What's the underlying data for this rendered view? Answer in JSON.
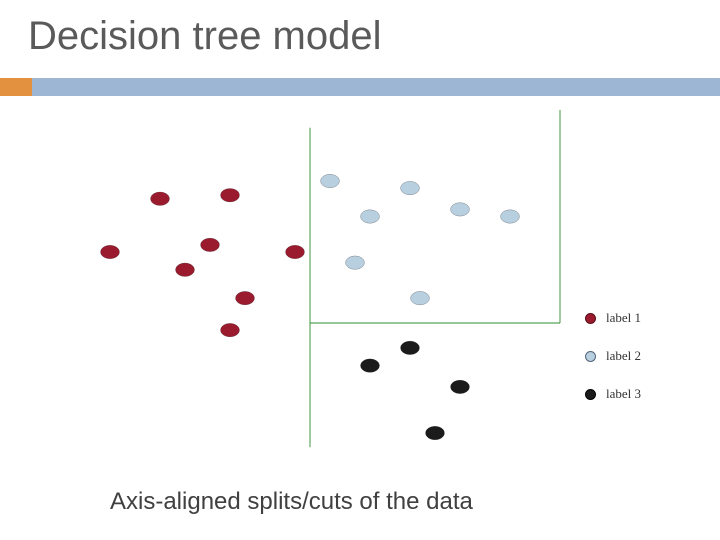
{
  "title": "Decision tree model",
  "caption": "Axis-aligned splits/cuts of the data",
  "legend": {
    "items": [
      {
        "label": "label 1"
      },
      {
        "label": "label 2"
      },
      {
        "label": "label 3"
      }
    ]
  },
  "chart_data": {
    "type": "scatter",
    "title": "",
    "xlabel": "",
    "ylabel": "",
    "xlim": [
      0,
      100
    ],
    "ylim": [
      0,
      100
    ],
    "series": [
      {
        "name": "label 1",
        "color": "#9a1b2e",
        "points": [
          {
            "x": 8,
            "y": 60
          },
          {
            "x": 18,
            "y": 75
          },
          {
            "x": 23,
            "y": 55
          },
          {
            "x": 28,
            "y": 62
          },
          {
            "x": 32,
            "y": 76
          },
          {
            "x": 32,
            "y": 38
          },
          {
            "x": 35,
            "y": 47
          },
          {
            "x": 45,
            "y": 60
          }
        ]
      },
      {
        "name": "label 2",
        "color": "#b8cfe0",
        "points": [
          {
            "x": 52,
            "y": 80
          },
          {
            "x": 57,
            "y": 57
          },
          {
            "x": 60,
            "y": 70
          },
          {
            "x": 68,
            "y": 78
          },
          {
            "x": 70,
            "y": 47
          },
          {
            "x": 78,
            "y": 72
          },
          {
            "x": 88,
            "y": 70
          }
        ]
      },
      {
        "name": "label 3",
        "color": "#1b1b1b",
        "points": [
          {
            "x": 60,
            "y": 28
          },
          {
            "x": 68,
            "y": 33
          },
          {
            "x": 73,
            "y": 9
          },
          {
            "x": 78,
            "y": 22
          }
        ]
      }
    ],
    "splits": [
      {
        "axis": "x",
        "at": 48,
        "from": 5,
        "to": 95
      },
      {
        "axis": "x",
        "at": 98,
        "from": 40,
        "to": 100
      },
      {
        "axis": "y",
        "at": 40,
        "x_from": 48,
        "x_to": 98
      }
    ]
  }
}
